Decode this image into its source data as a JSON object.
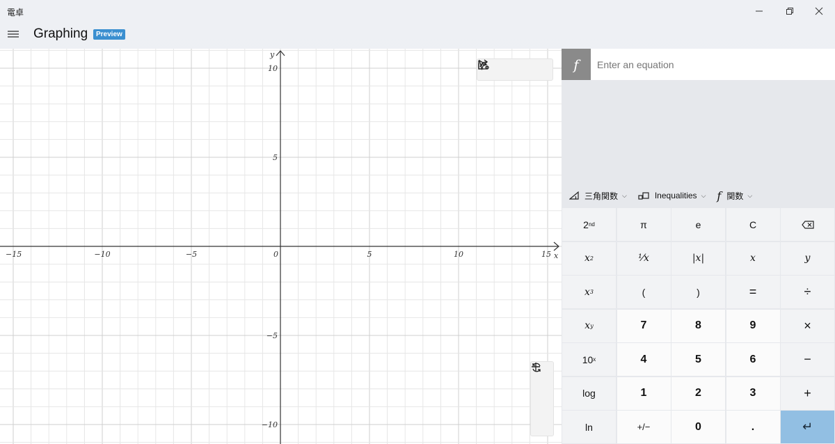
{
  "app": {
    "title": "電卓"
  },
  "window_controls": {
    "minimize": "—",
    "maximize": "❐",
    "close": "✕"
  },
  "header": {
    "mode_title": "Graphing",
    "badge": "Preview"
  },
  "graph": {
    "x_axis_label": "x",
    "y_axis_label": "y",
    "x_ticks": [
      "−15",
      "−10",
      "−5",
      "0",
      "5",
      "10",
      "15"
    ],
    "y_ticks": [
      "10",
      "5",
      "−5",
      "−10"
    ],
    "x_range": [
      -15,
      15
    ],
    "y_range": [
      -11,
      10.5
    ],
    "grid": true
  },
  "equation": {
    "fx_label": "f",
    "placeholder": "Enter an equation",
    "value": ""
  },
  "dropdowns": {
    "trig": "三角関数",
    "inequalities": "Inequalities",
    "functions": "関数",
    "functions_glyph": "f"
  },
  "keypad": {
    "row1": [
      "2",
      "π",
      "e",
      "C",
      ""
    ],
    "row1_sup": "nd",
    "row2": [
      "x",
      "¹⁄x",
      "|x|",
      "x",
      "y"
    ],
    "row3": [
      "x",
      "(",
      ")",
      "=",
      "÷"
    ],
    "row4": [
      "x",
      "7",
      "8",
      "9",
      "×"
    ],
    "row5": [
      "10",
      "4",
      "5",
      "6",
      "−"
    ],
    "row6": [
      "log",
      "1",
      "2",
      "3",
      "+"
    ],
    "row7": [
      "ln",
      "+/−",
      "0",
      ".",
      "↵"
    ],
    "sup_x2": "2",
    "sup_x3": "3",
    "sup_xy": "y",
    "sup_10x": "x"
  },
  "colors": {
    "accent": "#3b8fd0",
    "enter_key": "#92bfe3",
    "fx_box": "#8a8a8a"
  }
}
